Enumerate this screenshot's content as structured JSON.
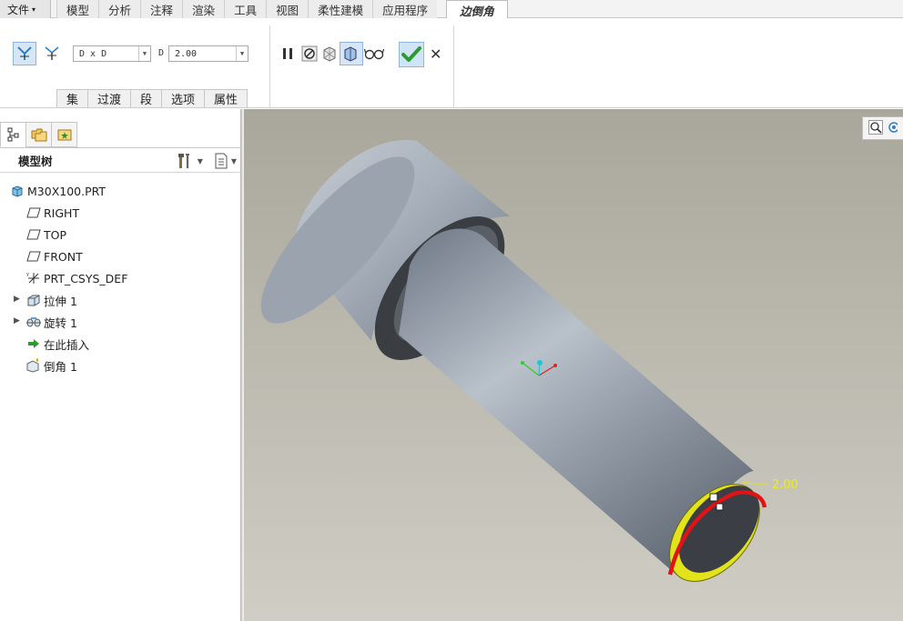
{
  "menu": {
    "file": "文件",
    "tabs": [
      "模型",
      "分析",
      "注释",
      "渲染",
      "工具",
      "视图",
      "柔性建模",
      "应用程序"
    ],
    "active_tab": "边倒角"
  },
  "ribbon": {
    "scheme_value": "D x D",
    "d_label": "D",
    "d_value": "2.00",
    "subtabs": [
      "集",
      "过渡",
      "段",
      "选项",
      "属性"
    ]
  },
  "panel": {
    "title": "模型树",
    "tree": [
      {
        "label": "M30X100.PRT",
        "icon": "part-icon",
        "expandable": false
      },
      {
        "label": "RIGHT",
        "icon": "datum-plane-icon",
        "expandable": false
      },
      {
        "label": "TOP",
        "icon": "datum-plane-icon",
        "expandable": false
      },
      {
        "label": "FRONT",
        "icon": "datum-plane-icon",
        "expandable": false
      },
      {
        "label": "PRT_CSYS_DEF",
        "icon": "csys-icon",
        "expandable": false
      },
      {
        "label": "拉伸 1",
        "icon": "extrude-icon",
        "expandable": true
      },
      {
        "label": "旋转 1",
        "icon": "revolve-icon",
        "expandable": true
      },
      {
        "label": "在此插入",
        "icon": "insert-arrow-icon",
        "expandable": false
      },
      {
        "label": "倒角 1",
        "icon": "chamfer-icon",
        "expandable": false
      }
    ]
  },
  "viewport": {
    "dimension_label": "2.00"
  },
  "colors": {
    "accent": "#2f7fc1",
    "ok_green": "#2e9b2e",
    "edge_highlight": "#e8e81a",
    "chamfer_red": "#e01414",
    "model_body": "#8e98a4"
  }
}
